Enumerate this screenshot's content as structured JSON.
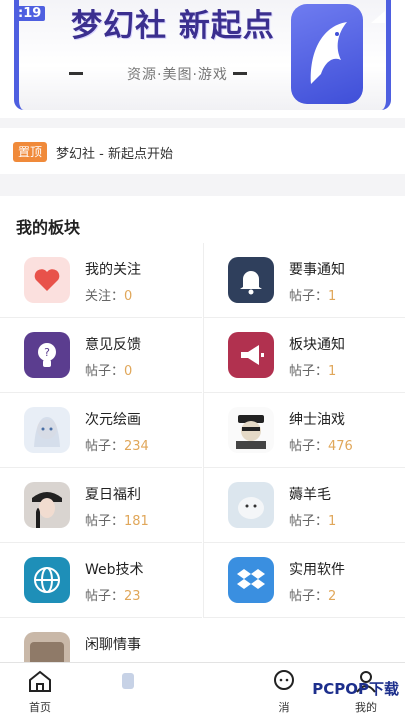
{
  "status": {
    "time": ":19"
  },
  "banner": {
    "title": "梦幻社 新起点",
    "subtitle": "资源·美图·游戏"
  },
  "notice": {
    "badge": "置顶",
    "text": "梦幻社 - 新起点开始"
  },
  "section": {
    "title": "我的板块"
  },
  "boards": [
    {
      "name": "我的关注",
      "count_label": "关注：",
      "count": "0",
      "icon": "heart-icon"
    },
    {
      "name": "要事通知",
      "count_label": "帖子：",
      "count": "1",
      "icon": "bell-icon"
    },
    {
      "name": "意见反馈",
      "count_label": "帖子：",
      "count": "0",
      "icon": "lightbulb-icon"
    },
    {
      "name": "板块通知",
      "count_label": "帖子：",
      "count": "1",
      "icon": "megaphone-icon"
    },
    {
      "name": "次元绘画",
      "count_label": "帖子：",
      "count": "234",
      "icon": "anime-girl-avatar"
    },
    {
      "name": "绅士油戏",
      "count_label": "帖子：",
      "count": "476",
      "icon": "meme-avatar"
    },
    {
      "name": "夏日福利",
      "count_label": "帖子：",
      "count": "181",
      "icon": "girl-photo-avatar"
    },
    {
      "name": "薅羊毛",
      "count_label": "帖子：",
      "count": "1",
      "icon": "sheep-avatar"
    },
    {
      "name": "Web技术",
      "count_label": "帖子：",
      "count": "23",
      "icon": "globe-icon"
    },
    {
      "name": "实用软件",
      "count_label": "帖子：",
      "count": "2",
      "icon": "dropbox-icon"
    },
    {
      "name": "闲聊情事",
      "count_label": "",
      "count": "",
      "icon": "chat-avatar"
    }
  ],
  "tabbar": {
    "home": "首页",
    "messages": "消",
    "mine": "我的"
  },
  "watermark": "PCPOP下载",
  "colors": {
    "accent": "#4e5fe0",
    "badge": "#f08a3a",
    "count": "#e0a75a"
  }
}
